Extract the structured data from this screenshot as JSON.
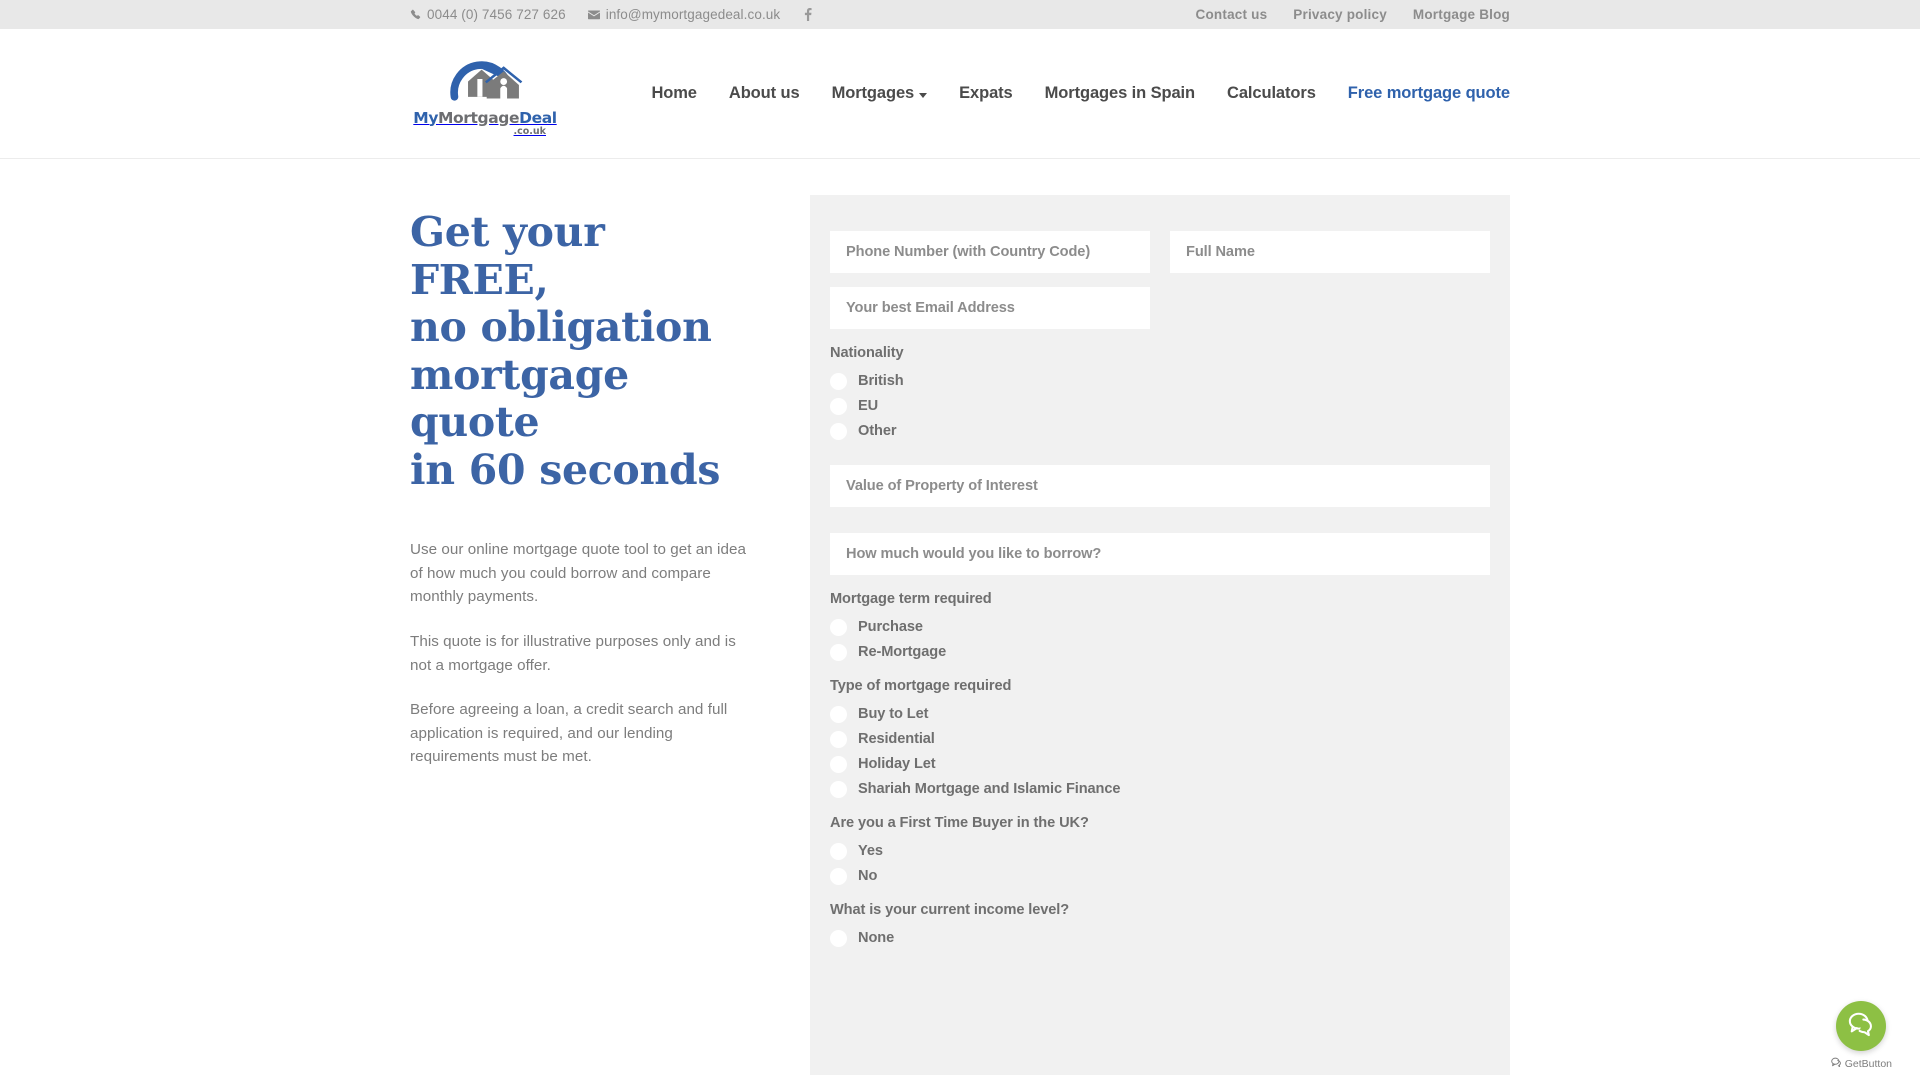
{
  "topbar": {
    "phone": "0044 (0) 7456 727 626",
    "email": "info@mymortgagedeal.co.uk",
    "social": [
      {
        "name": "facebook-icon",
        "label": "f"
      }
    ],
    "links": [
      {
        "label": "Contact us"
      },
      {
        "label": "Privacy policy"
      },
      {
        "label": "Mortgage Blog"
      }
    ]
  },
  "header": {
    "logo": {
      "part1": "My",
      "part2": "Mortgage",
      "part3": "Deal",
      "tld": ".co.uk"
    },
    "nav": [
      {
        "label": "Home",
        "active": false,
        "caret": false
      },
      {
        "label": "About us",
        "active": false,
        "caret": false
      },
      {
        "label": "Mortgages",
        "active": false,
        "caret": true
      },
      {
        "label": "Expats",
        "active": false,
        "caret": false
      },
      {
        "label": "Mortgages in Spain",
        "active": false,
        "caret": false
      },
      {
        "label": "Calculators",
        "active": false,
        "caret": false
      },
      {
        "label": "Free mortgage quote",
        "active": true,
        "caret": false
      }
    ]
  },
  "hero": {
    "title_line1": "Get your FREE,",
    "title_line2": "no obligation",
    "title_line3": "mortgage quote",
    "title_line4": "in 60 seconds",
    "paragraph1": "Use our online mortgage quote tool to get an idea of how much you could borrow and compare monthly payments.",
    "paragraph2": "This quote is for illustrative purposes only and is not a mortgage offer.",
    "paragraph3": "Before agreeing a loan, a credit search and full application is required, and our lending requirements must be met."
  },
  "form": {
    "phone_placeholder": "Phone Number (with Country Code)",
    "name_placeholder": "Full Name",
    "email_placeholder": "Your best Email Address",
    "property_value_placeholder": "Value of Property of Interest",
    "borrow_placeholder": "How much would you like to borrow?",
    "groups": [
      {
        "label": "Nationality",
        "options": [
          "British",
          "EU",
          "Other"
        ]
      },
      {
        "label": "Mortgage term required",
        "options": [
          "Purchase",
          "Re-Mortgage"
        ]
      },
      {
        "label": "Type of mortgage required",
        "options": [
          "Buy to Let",
          "Residential",
          "Holiday Let",
          "Shariah Mortgage and Islamic Finance"
        ]
      },
      {
        "label": "Are you a First Time Buyer in the UK?",
        "options": [
          "Yes",
          "No"
        ]
      },
      {
        "label": "What is your current income level?",
        "options": [
          "None"
        ]
      }
    ]
  },
  "chat": {
    "credit": "GetButton",
    "accent_color": "#8dc044"
  },
  "colors": {
    "brand_blue": "#2f62ac",
    "heading_blue": "#3c64a5",
    "topbar_bg": "#e8e8e8",
    "panel_bg": "#f1f1f1",
    "muted_text": "#8c8c8c"
  }
}
